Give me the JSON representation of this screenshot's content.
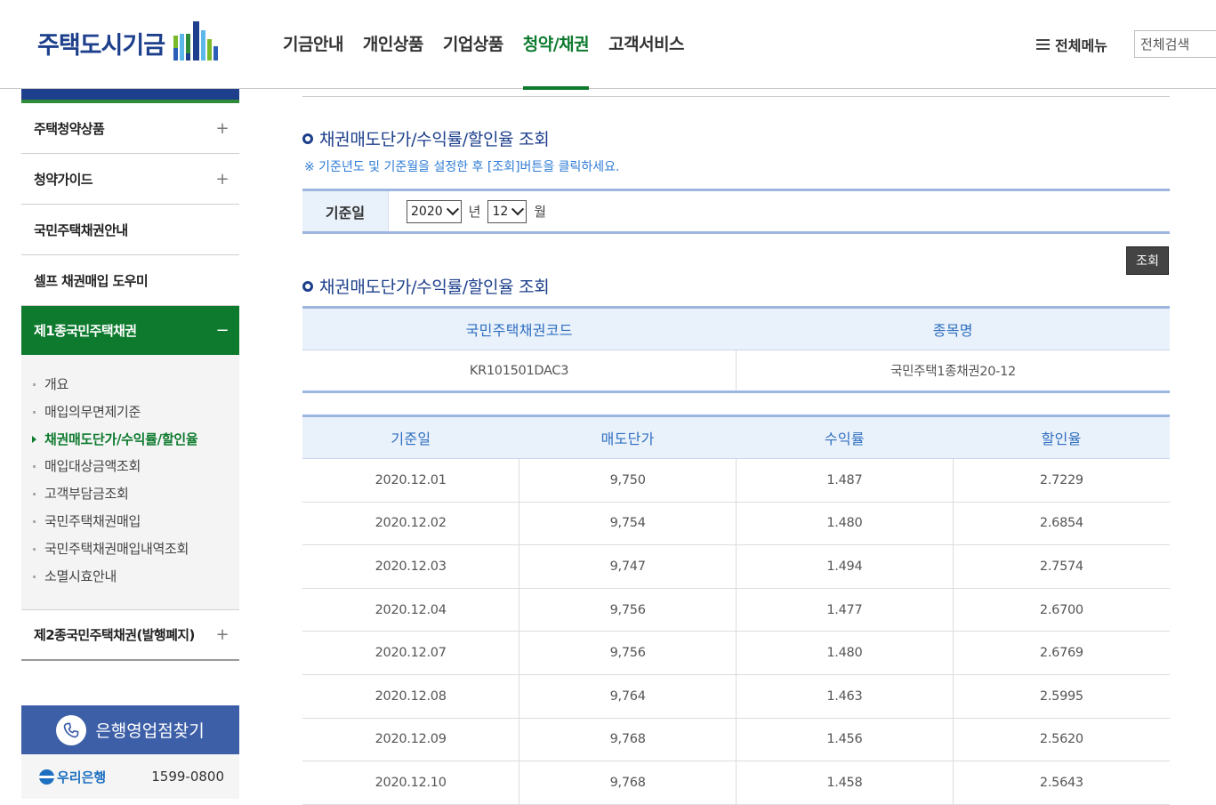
{
  "header": {
    "logo_text": "주택도시기금",
    "nav": [
      "기금안내",
      "개인상품",
      "기업상품",
      "청약/채권",
      "고객서비스"
    ],
    "active_nav": 3,
    "all_menu": "전체메뉴",
    "search_value": "전체검색"
  },
  "sidebar": {
    "items_top": [
      {
        "label": "주택청약상품",
        "pm": "+"
      },
      {
        "label": "청약가이드",
        "pm": "+"
      },
      {
        "label": "국민주택채권안내",
        "pm": ""
      },
      {
        "label": "셀프 채권매입 도우미",
        "pm": ""
      }
    ],
    "active_item": {
      "label": "제1종국민주택채권",
      "pm": "−"
    },
    "sub_items": [
      "개요",
      "매입의무면제기준",
      "채권매도단가/수익률/할인율",
      "매입대상금액조회",
      "고객부담금조회",
      "국민주택채권매입",
      "국민주택채권매입내역조회",
      "소멸시효안내"
    ],
    "active_sub": 2,
    "item_last": {
      "label": "제2종국민주택채권(발행폐지)",
      "pm": "+"
    },
    "bank_box": {
      "title": "은행영업점찾기",
      "bank_name": "우리은행",
      "phone": "1599-0800"
    }
  },
  "main": {
    "section1_title": "채권매도단가/수익률/할인율 조회",
    "notice": "※ 기준년도 및 기준월을 설정한 후 [조회]버튼을 클릭하세요.",
    "filter": {
      "label": "기준일",
      "year": "2020",
      "year_unit": "년",
      "month": "12",
      "month_unit": "월"
    },
    "search_button": "조회",
    "section2_title": "채권매도단가/수익률/할인율 조회",
    "code_table": {
      "headers": [
        "국민주택채권코드",
        "종목명"
      ],
      "row": [
        "KR101501DAC3",
        "국민주택1종채권20-12"
      ]
    },
    "data_table": {
      "headers": [
        "기준일",
        "매도단가",
        "수익률",
        "할인율"
      ],
      "rows": [
        [
          "2020.12.01",
          "9,750",
          "1.487",
          "2.7229"
        ],
        [
          "2020.12.02",
          "9,754",
          "1.480",
          "2.6854"
        ],
        [
          "2020.12.03",
          "9,747",
          "1.494",
          "2.7574"
        ],
        [
          "2020.12.04",
          "9,756",
          "1.477",
          "2.6700"
        ],
        [
          "2020.12.07",
          "9,756",
          "1.480",
          "2.6769"
        ],
        [
          "2020.12.08",
          "9,764",
          "1.463",
          "2.5995"
        ],
        [
          "2020.12.09",
          "9,768",
          "1.456",
          "2.5620"
        ],
        [
          "2020.12.10",
          "9,768",
          "1.458",
          "2.5643"
        ]
      ]
    }
  },
  "colors": {
    "brand_blue": "#1d3f8c",
    "active_green": "#0d7a2e",
    "table_head_bg": "#e9f1fb",
    "table_head_text": "#2f6fc0"
  }
}
